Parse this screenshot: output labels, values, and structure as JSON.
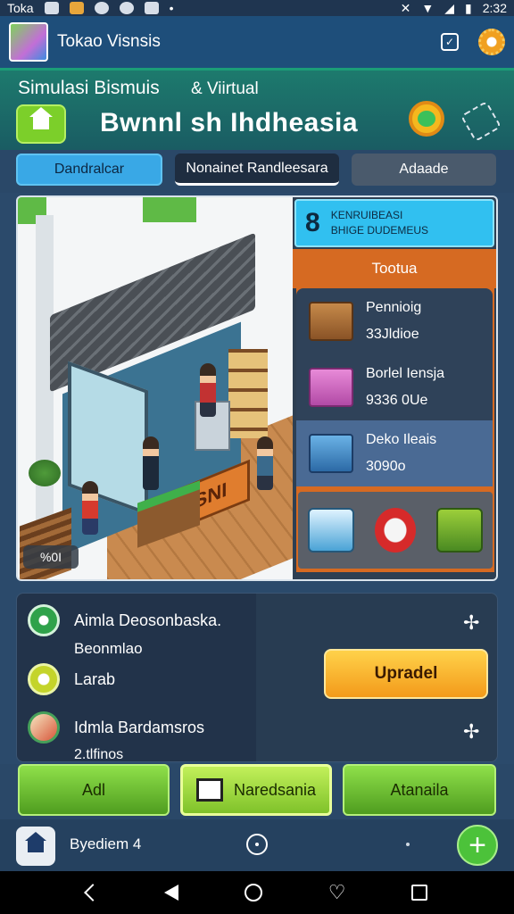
{
  "status_bar": {
    "app_name": "Toka",
    "time": "2:32"
  },
  "app_bar": {
    "title": "Tokao Visnsis"
  },
  "header": {
    "subtitle": "Simulasi Bismuis",
    "subtitle_tag": "& Viirtual",
    "title": "Bwnnl sh Ihdheasia"
  },
  "tabs": [
    {
      "label": "Dandralcar"
    },
    {
      "label": "Nonainet Randleesara"
    },
    {
      "label": "Adaade"
    }
  ],
  "scene": {
    "store_sign": "BISNI",
    "badge": "%0I"
  },
  "side_panel": {
    "level": "8",
    "headline_1": "KENRUIBEASI",
    "headline_2": "BHIGE DUDEMEUS",
    "category": "Tootua",
    "items": [
      {
        "name": "Pennioig",
        "price": "33Jldioe"
      },
      {
        "name": "Borlel Iensja",
        "price": "9336 0Ue"
      },
      {
        "name": "Deko Ileais",
        "price": "3090o"
      }
    ]
  },
  "stats": {
    "row1_label": "Aimla Deosonbaska.",
    "row1_sub": "Beonmlao",
    "row2_label": "Larab",
    "row3_label": "Idmla Bardamsros",
    "row3_sub": "2.tlfinos",
    "upgrade_label": "Upradel"
  },
  "actions": {
    "btn1": "Adl",
    "btn2": "Naredsania",
    "btn3": "Atanaila"
  },
  "nav": {
    "label": "Byediem 4",
    "plus": "+"
  }
}
